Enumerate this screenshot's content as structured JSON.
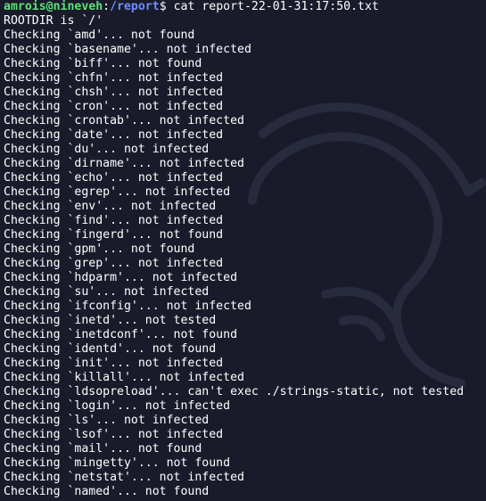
{
  "prompt": {
    "user_host": "amrois@nineveh",
    "separator": ":",
    "path": "/report",
    "symbol": "$",
    "command": " cat report-22-01-31:17:50.txt"
  },
  "output": [
    "ROOTDIR is `/'",
    "Checking `amd'... not found",
    "Checking `basename'... not infected",
    "Checking `biff'... not found",
    "Checking `chfn'... not infected",
    "Checking `chsh'... not infected",
    "Checking `cron'... not infected",
    "Checking `crontab'... not infected",
    "Checking `date'... not infected",
    "Checking `du'... not infected",
    "Checking `dirname'... not infected",
    "Checking `echo'... not infected",
    "Checking `egrep'... not infected",
    "Checking `env'... not infected",
    "Checking `find'... not infected",
    "Checking `fingerd'... not found",
    "Checking `gpm'... not found",
    "Checking `grep'... not infected",
    "Checking `hdparm'... not infected",
    "Checking `su'... not infected",
    "Checking `ifconfig'... not infected",
    "Checking `inetd'... not tested",
    "Checking `inetdconf'... not found",
    "Checking `identd'... not found",
    "Checking `init'... not infected",
    "Checking `killall'... not infected",
    "Checking `ldsopreload'... can't exec ./strings-static, not tested",
    "Checking `login'... not infected",
    "Checking `ls'... not infected",
    "Checking `lsof'... not infected",
    "Checking `mail'... not found",
    "Checking `mingetty'... not found",
    "Checking `netstat'... not infected",
    "Checking `named'... not found"
  ],
  "colors": {
    "background": "#1a1b2a",
    "text": "#ffffff",
    "user_host": "#5fe07a",
    "path": "#6f8cff"
  },
  "watermark_icon": "kali-dragon-icon"
}
